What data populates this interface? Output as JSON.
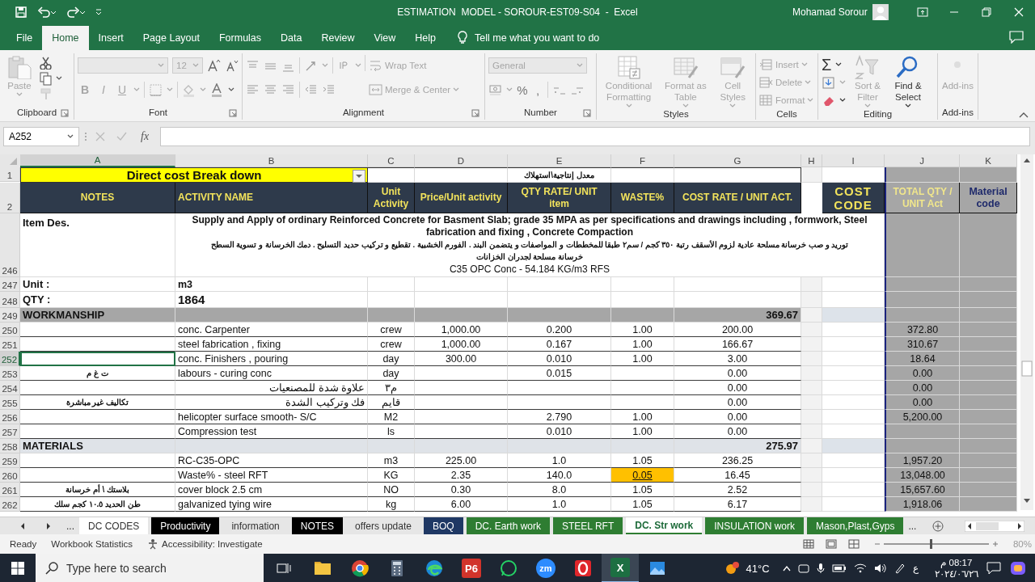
{
  "title_bar": {
    "title": "ESTIMATION  MODEL - SOROUR-EST09-S04  -  Excel",
    "user": "Mohamad Sorour"
  },
  "menu_tabs": [
    {
      "label": "File",
      "selected": false
    },
    {
      "label": "Home",
      "selected": true
    },
    {
      "label": "Insert",
      "selected": false
    },
    {
      "label": "Page Layout",
      "selected": false
    },
    {
      "label": "Formulas",
      "selected": false
    },
    {
      "label": "Data",
      "selected": false
    },
    {
      "label": "Review",
      "selected": false
    },
    {
      "label": "View",
      "selected": false
    },
    {
      "label": "Help",
      "selected": false
    }
  ],
  "tell_me": "Tell me what you want to do",
  "ribbon": {
    "clipboard": {
      "label": "Clipboard",
      "paste": {
        "label": "Paste",
        "disabled": true
      }
    },
    "font": {
      "label": "Font",
      "size": "12",
      "styles": [
        "B",
        "I",
        "U"
      ]
    },
    "alignment": {
      "label": "Alignment",
      "wrap_text": {
        "label": "Wrap Text",
        "disabled": true
      },
      "merge": {
        "label": "Merge & Center",
        "disabled": true
      }
    },
    "number": {
      "label": "Number",
      "format": "General",
      "symbols": [
        "%",
        ","
      ]
    },
    "styles": {
      "label": "Styles",
      "buttons": [
        {
          "label": "Conditional Formatting",
          "disabled": true
        },
        {
          "label": "Format as Table",
          "disabled": true
        },
        {
          "label": "Cell Styles",
          "disabled": true
        }
      ]
    },
    "cells": {
      "label": "Cells",
      "buttons": [
        {
          "label": "Insert",
          "disabled": true
        },
        {
          "label": "Delete",
          "disabled": true
        },
        {
          "label": "Format",
          "disabled": true
        }
      ]
    },
    "editing": {
      "label": "Editing",
      "autosum": "Σ",
      "buttons": [
        {
          "label": "Sort & Filter",
          "disabled": true
        },
        {
          "label": "Find & Select",
          "disabled": false
        }
      ]
    },
    "addins": {
      "label": "Add-ins",
      "buttons": [
        {
          "label": "Add-ins",
          "disabled": true
        }
      ]
    }
  },
  "formula_bar": {
    "name_box": "A252",
    "function_label": "fx"
  },
  "sheet": {
    "columns": [
      {
        "label": "A",
        "selected": true
      },
      {
        "label": "B",
        "selected": false
      },
      {
        "label": "C",
        "selected": false
      },
      {
        "label": "D",
        "selected": false
      },
      {
        "label": "E",
        "selected": false
      },
      {
        "label": "F",
        "selected": false
      },
      {
        "label": "G",
        "selected": false
      },
      {
        "label": "H",
        "selected": false
      },
      {
        "label": "I",
        "selected": false
      },
      {
        "label": "J",
        "selected": false
      },
      {
        "label": "K",
        "selected": false
      }
    ],
    "rows": [
      {
        "number": "1",
        "kind": "title",
        "selected": false,
        "title": "Direct cost Break down",
        "cells": {
          "e": "معدل إنتاجية\\استهلاك"
        }
      },
      {
        "number": "2",
        "kind": "header",
        "selected": false,
        "cells": {
          "a": "NOTES",
          "b": "ACTIVITY NAME",
          "c": "Unit Activity",
          "d": "Price/Unit activity",
          "e": "QTY RATE/ UNIT item",
          "f": "WASTE%",
          "g": "COST RATE / UNIT ACT.",
          "i": "COST CODE",
          "j": "TOTAL QTY / UNIT Act",
          "k": "Material code"
        }
      },
      {
        "number": "246",
        "kind": "description",
        "selected": false,
        "cells": {
          "a": "Item Des."
        },
        "description": {
          "english": "Supply and Apply of  ordinary  Reinforced Concrete for  Basment  Slab; grade 35 MPA as per specifications and drawings including , formwork, Steel fabrication and fixing , Concrete Compaction",
          "arabic": [
            "توريد و صب خرسانة مسلحة عادية لزوم الأسقف  رتبة ٣٥٠ كجم / سم٢  طبقا للمخططات و المواصفات و يتضمن البند . الفورم الخشبية . تقطيع و تركيب حديد التسليح . دمك الخرسانة و تسوية السطح",
            "خرسانة مسلحة لجدران الخزانات"
          ],
          "spec": "C35 OPC Conc  - 54.184 KG/m3 RFS"
        }
      },
      {
        "number": "247",
        "kind": "info",
        "selected": false,
        "cells": {
          "a": "Unit :",
          "b": "m3"
        }
      },
      {
        "number": "248",
        "kind": "quantity",
        "selected": false,
        "cells": {
          "a": "QTY :",
          "b": "1864"
        }
      },
      {
        "number": "249",
        "kind": "section",
        "color": "#a6a6a6",
        "selected": false,
        "cells": {
          "a": "WORKMANSHIP",
          "g": "369.67"
        }
      },
      {
        "number": "250",
        "kind": "item",
        "selected": false,
        "cells": {
          "b": "conc. Carpenter",
          "c": "crew",
          "d": "1,000.00",
          "e": "0.200",
          "f": "1.00",
          "g": "200.00",
          "j": "372.80"
        }
      },
      {
        "number": "251",
        "kind": "item",
        "selected": false,
        "cells": {
          "b": "steel fabrication , fixing",
          "c": "crew",
          "d": "1,000.00",
          "e": "0.167",
          "f": "1.00",
          "g": "166.67",
          "j": "310.67"
        }
      },
      {
        "number": "252",
        "kind": "item",
        "selected": true,
        "cells": {
          "b": "conc. Finishers , pouring",
          "c": "day",
          "d": "300.00",
          "e": "0.010",
          "f": "1.00",
          "g": "3.00",
          "j": "18.64"
        }
      },
      {
        "number": "253",
        "kind": "item",
        "selected": false,
        "cells": {
          "a": "ت غ م",
          "b": "labours - curing conc",
          "c": "day",
          "e": "0.015",
          "g": "0.00",
          "j": "0.00"
        }
      },
      {
        "number": "254",
        "kind": "item",
        "selected": false,
        "cells": {
          "b": "علاوة شدة للمصنعيات",
          "c": "م٣",
          "g": "0.00",
          "j": "0.00"
        }
      },
      {
        "number": "255",
        "kind": "item",
        "selected": false,
        "cells": {
          "a": "تكاليف غير مباشرة",
          "b": "فك وتركيب الشدة",
          "c": "قايم",
          "g": "0.00",
          "j": "0.00"
        }
      },
      {
        "number": "256",
        "kind": "item",
        "selected": false,
        "cells": {
          "b": "helicopter surface smooth- S/C",
          "c": "M2",
          "e": "2.790",
          "f": "1.00",
          "g": "0.00",
          "j": "5,200.00"
        }
      },
      {
        "number": "257",
        "kind": "item",
        "selected": false,
        "cells": {
          "b": "Compression test",
          "c": "ls",
          "e": "0.010",
          "f": "1.00",
          "g": "0.00"
        }
      },
      {
        "number": "258",
        "kind": "section",
        "color": "#dfe3e8",
        "selected": false,
        "cells": {
          "a": "MATERIALS",
          "g": "275.97"
        }
      },
      {
        "number": "259",
        "kind": "item",
        "selected": false,
        "cells": {
          "b": "RC-C35-OPC",
          "c": "m3",
          "d": "225.00",
          "e": "1.0",
          "f": "1.05",
          "g": "236.25",
          "j": "1,957.20"
        }
      },
      {
        "number": "260",
        "kind": "item",
        "selected": false,
        "cells": {
          "b": "Waste% - steel RFT",
          "c": "KG",
          "d": "2.35",
          "e": "140.0",
          "f": {
            "text": "0.05",
            "highlighted": true
          },
          "g": "16.45",
          "j": "13,048.00"
        }
      },
      {
        "number": "261",
        "kind": "item",
        "selected": false,
        "cells": {
          "a": "بلاستك \\ أم خرسانة",
          "b": "cover block 2.5 cm",
          "c": "NO",
          "d": "0.30",
          "e": "8.0",
          "f": "1.05",
          "g": "2.52",
          "j": "15,657.60"
        }
      },
      {
        "number": "262",
        "kind": "item",
        "selected": false,
        "cells": {
          "a": "طن الحديد ١٠.٥ كجم سلك",
          "b": "galvanized tying wire",
          "c": "kg",
          "d": "6.00",
          "e": "1.0",
          "f": "1.05",
          "g": "6.17",
          "j": "1,918.06"
        }
      }
    ]
  },
  "sheet_tabs": {
    "more_left": "...",
    "more_right": "...",
    "tabs": [
      {
        "label": "DC CODES",
        "color": "#ffffff",
        "selected": false
      },
      {
        "label": "Productivity",
        "color": "#000000",
        "selected": false
      },
      {
        "label": "information",
        "color": "#e6e6e6",
        "selected": false
      },
      {
        "label": "NOTES",
        "color": "#000000",
        "selected": false
      },
      {
        "label": "offers update",
        "color": "#e6e6e6",
        "selected": false
      },
      {
        "label": "BOQ",
        "color": "#1f3864",
        "selected": false
      },
      {
        "label": "DC. Earth work",
        "color": "#2e7d32",
        "selected": false
      },
      {
        "label": "STEEL RFT",
        "color": "#2e7d32",
        "selected": false
      },
      {
        "label": "DC. Str work",
        "color": "#2e7d32",
        "selected": true
      },
      {
        "label": "INSULATION work",
        "color": "#2e7d32",
        "selected": false
      },
      {
        "label": "Mason,Plast,Gyps",
        "color": "#2e7d32",
        "selected": false
      }
    ]
  },
  "status_bar": {
    "mode": "Ready",
    "workbook_statistics": "Workbook Statistics",
    "accessibility": "Accessibility: Investigate",
    "zoom_slider": {
      "level": 0.45
    },
    "zoom": "80%"
  },
  "taskbar": {
    "search_placeholder": "Type here to search",
    "apps": [
      {
        "kind": "explorer",
        "selected": false
      },
      {
        "kind": "chrome",
        "selected": false
      },
      {
        "kind": "calculator",
        "selected": false
      },
      {
        "kind": "edge",
        "selected": false
      },
      {
        "kind": "p6",
        "label": "P6",
        "selected": false
      },
      {
        "kind": "whatsapp",
        "selected": false
      },
      {
        "kind": "zoom",
        "label": "zm",
        "selected": false
      },
      {
        "kind": "opera",
        "selected": false
      },
      {
        "kind": "excel",
        "label": "X",
        "selected": true
      },
      {
        "kind": "photos",
        "selected": false
      }
    ],
    "temperature": "41°C",
    "language": "ع",
    "time": "08:17 م",
    "date": "٢٠٢٤/٠٦/٢٦"
  }
}
